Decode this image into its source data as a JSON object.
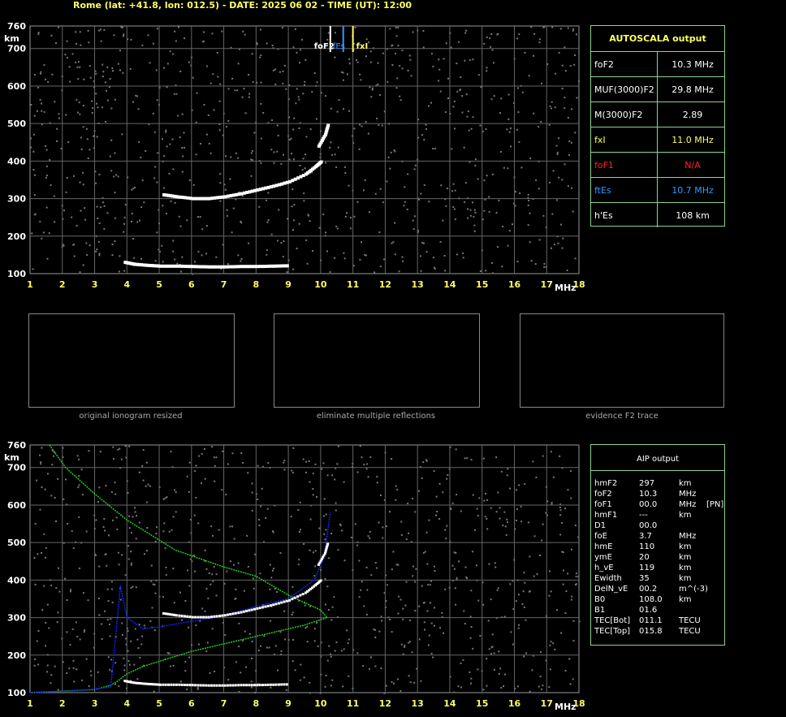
{
  "header": "Rome (lat: +41.8, lon: 012.5) - DATE: 2025 06 02 - TIME (UT): 12:00",
  "colors": {
    "yellow": "#ffff66",
    "green": "#8fd18f",
    "red": "#ff2222",
    "blue": "#3399ff",
    "curve_green": "#22cc22",
    "curve_blue": "#1122ee"
  },
  "autoscala": {
    "title": "AUTOSCALA output",
    "rows": [
      {
        "key": "foF2",
        "value": "10.3 MHz",
        "color": "#ffffff"
      },
      {
        "key": "MUF(3000)F2",
        "value": "29.8 MHz",
        "color": "#ffffff"
      },
      {
        "key": "M(3000)F2",
        "value": "2.89",
        "color": "#ffffff"
      },
      {
        "key": "fxI",
        "value": "11.0 MHz",
        "color": "#ffff66"
      },
      {
        "key": "foF1",
        "value": "N/A",
        "color": "#ff2222"
      },
      {
        "key": "ftEs",
        "value": "10.7 MHz",
        "color": "#3399ff"
      },
      {
        "key": "h'Es",
        "value": "108     km",
        "color": "#ffffff"
      }
    ]
  },
  "aip": {
    "title": "AIP output",
    "rows": [
      {
        "name": "hmF2",
        "value": "297",
        "unit": "km",
        "extra": ""
      },
      {
        "name": "foF2",
        "value": "10.3",
        "unit": "MHz",
        "extra": ""
      },
      {
        "name": "foF1",
        "value": "00.0",
        "unit": "MHz",
        "extra": "[PN]"
      },
      {
        "name": "hmF1",
        "value": "---",
        "unit": "km",
        "extra": ""
      },
      {
        "name": "D1",
        "value": "00.0",
        "unit": "",
        "extra": ""
      },
      {
        "name": "foE",
        "value": "3.7",
        "unit": "MHz",
        "extra": ""
      },
      {
        "name": "hmE",
        "value": "110",
        "unit": "km",
        "extra": ""
      },
      {
        "name": "ymE",
        "value": "20",
        "unit": "km",
        "extra": ""
      },
      {
        "name": "h_vE",
        "value": "119",
        "unit": "km",
        "extra": ""
      },
      {
        "name": "Ewidth",
        "value": "35",
        "unit": "km",
        "extra": ""
      },
      {
        "name": "DelN_vE",
        "value": "00.2",
        "unit": "m^(-3)",
        "extra": ""
      },
      {
        "name": "B0",
        "value": "108.0",
        "unit": "km",
        "extra": ""
      },
      {
        "name": "B1",
        "value": "01.6",
        "unit": "",
        "extra": ""
      },
      {
        "name": "TEC[Bot]",
        "value": "011.1",
        "unit": "TECU",
        "extra": ""
      },
      {
        "name": "TEC[Top]",
        "value": "015.8",
        "unit": "TECU",
        "extra": ""
      }
    ]
  },
  "captions": [
    "original ionogram resized",
    "eliminate multiple reflections",
    "evidence F2 trace"
  ],
  "markers": {
    "foF2_label": "foF2",
    "fts_label": "fEs",
    "fxl_label": "fxI"
  },
  "chart_data": [
    {
      "type": "scatter",
      "title": "",
      "xlabel": "MHz",
      "ylabel": "km",
      "x_ticks": [
        1,
        2,
        3,
        4,
        5,
        6,
        7,
        8,
        9,
        10,
        11,
        12,
        13,
        14,
        15,
        16,
        17,
        18
      ],
      "y_ticks": [
        100,
        200,
        300,
        400,
        500,
        600,
        700,
        760
      ],
      "xlim": [
        1,
        18
      ],
      "ylim": [
        100,
        760
      ],
      "grid": true,
      "series": [
        {
          "role": "E-trace",
          "points": [
            [
              3.9,
              130
            ],
            [
              4.2,
              125
            ],
            [
              4.6,
              122
            ],
            [
              5,
              120
            ],
            [
              5.5,
              120
            ],
            [
              6,
              119
            ],
            [
              6.5,
              118
            ],
            [
              7,
              118
            ],
            [
              7.5,
              119
            ],
            [
              8,
              119
            ],
            [
              8.5,
              120
            ],
            [
              9,
              121
            ]
          ]
        },
        {
          "role": "F2-trace",
          "points": [
            [
              5.1,
              310
            ],
            [
              5.5,
              305
            ],
            [
              6,
              300
            ],
            [
              6.5,
              300
            ],
            [
              7,
              305
            ],
            [
              7.5,
              313
            ],
            [
              8,
              323
            ],
            [
              8.5,
              333
            ],
            [
              9,
              345
            ],
            [
              9.5,
              365
            ],
            [
              9.8,
              385
            ],
            [
              10.0,
              400
            ]
          ]
        },
        {
          "role": "F2-upper",
          "points": [
            [
              9.9,
              440
            ],
            [
              10.1,
              470
            ],
            [
              10.2,
              500
            ]
          ]
        }
      ],
      "markers": [
        {
          "label": "foF2",
          "x": 10.3
        },
        {
          "label": "fEs",
          "x": 10.7
        },
        {
          "label": "fxI",
          "x": 11.0
        }
      ]
    },
    {
      "type": "line",
      "title": "",
      "xlabel": "MHz",
      "ylabel": "km",
      "x_ticks": [
        1,
        2,
        3,
        4,
        5,
        6,
        7,
        8,
        9,
        10,
        11,
        12,
        13,
        14,
        15,
        16,
        17,
        18
      ],
      "y_ticks": [
        100,
        200,
        300,
        400,
        500,
        600,
        700,
        760
      ],
      "xlim": [
        1,
        18
      ],
      "ylim": [
        100,
        760
      ],
      "grid": true,
      "series": [
        {
          "role": "profile-green",
          "color": "#22cc22",
          "points": [
            [
              1.6,
              760
            ],
            [
              2.1,
              700
            ],
            [
              3,
              630
            ],
            [
              4,
              560
            ],
            [
              5.5,
              480
            ],
            [
              7,
              435
            ],
            [
              8,
              410
            ],
            [
              9,
              360
            ],
            [
              10,
              320
            ],
            [
              10.2,
              300
            ],
            [
              9.5,
              280
            ],
            [
              8,
              250
            ],
            [
              6,
              210
            ],
            [
              4.5,
              170
            ],
            [
              4,
              150
            ],
            [
              3.7,
              130
            ],
            [
              3.5,
              120
            ],
            [
              3,
              108
            ],
            [
              1,
              100
            ]
          ]
        },
        {
          "role": "profile-blue",
          "color": "#1122ee",
          "points": [
            [
              1,
              100
            ],
            [
              2.5,
              105
            ],
            [
              3.5,
              115
            ],
            [
              3.8,
              385
            ],
            [
              4,
              300
            ],
            [
              4.5,
              270
            ],
            [
              5,
              275
            ],
            [
              6,
              290
            ],
            [
              7,
              305
            ],
            [
              8,
              330
            ],
            [
              9,
              350
            ],
            [
              9.8,
              400
            ],
            [
              10.1,
              460
            ],
            [
              10.3,
              580
            ]
          ]
        }
      ]
    }
  ]
}
